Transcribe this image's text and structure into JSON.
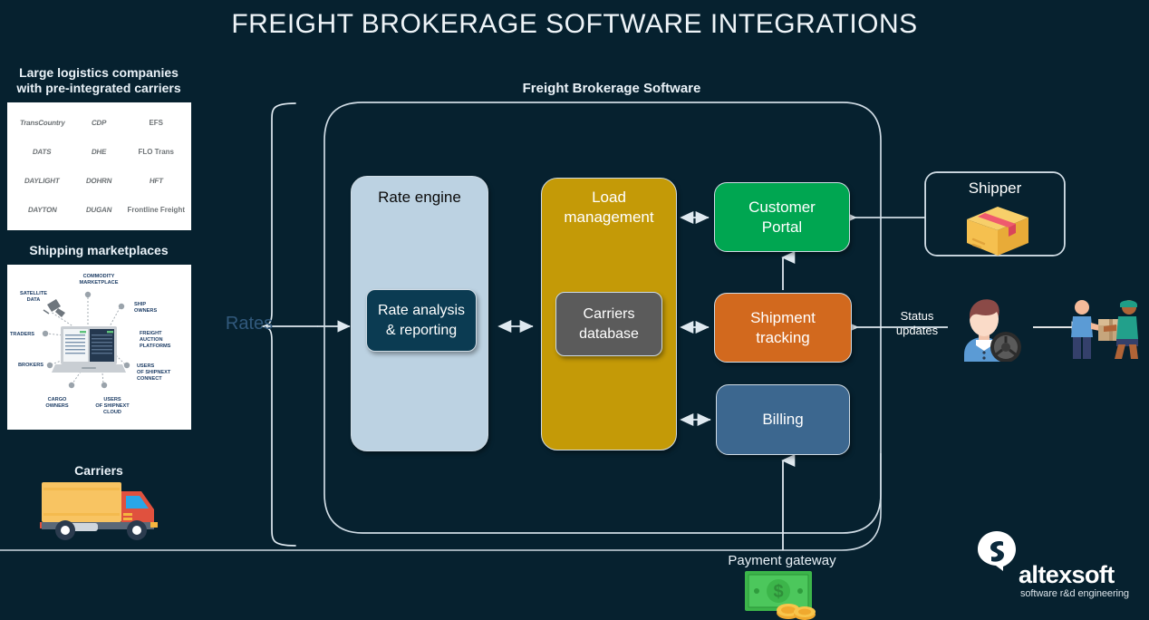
{
  "page": {
    "title": "FREIGHT BROKERAGE SOFTWARE INTEGRATIONS",
    "background_color": "#06212f"
  },
  "left_panel": {
    "logistics_label_line1": "Large logistics companies",
    "logistics_label_line2": "with pre-integrated carriers",
    "marketplaces_label": "Shipping marketplaces",
    "carriers_label": "Carriers",
    "carrier_logos": [
      "TransCountry",
      "CDP",
      "EFS",
      "DATS",
      "DHE",
      "FLO Trans",
      "DAYLIGHT",
      "DOHRN",
      "HFT",
      "DAYTON",
      "DUGAN",
      "Frontline Freight"
    ],
    "marketplace_diagram": {
      "center": "laptop",
      "nodes": [
        "COMMODITY MARKETPLACE",
        "SATELLITE DATA",
        "SHIP OWNERS",
        "FREIGHT AUCTION PLATFORMS",
        "TRADERS",
        "USERS OF SHIPNEXT CONNECT",
        "BROKERS",
        "CARGO OWNERS",
        "USERS OF SHIPNEXT CLOUD"
      ]
    }
  },
  "connector": {
    "rates_label": "Rates"
  },
  "container": {
    "label": "Freight Brokerage Software"
  },
  "nodes": {
    "rate_engine": {
      "label": "Rate engine",
      "color": "#bcd2e2"
    },
    "rate_analysis": {
      "label": "Rate analysis\n& reporting",
      "line1": "Rate analysis",
      "line2": "& reporting",
      "color": "#0b3b52"
    },
    "load_management": {
      "label": "Load\nmanagement",
      "line1": "Load",
      "line2": "management",
      "color": "#c49a07"
    },
    "carriers_database": {
      "line1": "Carriers",
      "line2": "database",
      "color": "#5b5b5b"
    },
    "customer_portal": {
      "line1": "Customer",
      "line2": "Portal",
      "color": "#00a651"
    },
    "shipment_tracking": {
      "line1": "Shipment",
      "line2": "tracking",
      "color": "#d2691e"
    },
    "billing": {
      "label": "Billing",
      "color": "#3c678f"
    },
    "shipper": {
      "label": "Shipper"
    }
  },
  "labels": {
    "status_updates_line1": "Status",
    "status_updates_line2": "updates",
    "payment_gateway": "Payment gateway"
  },
  "brand": {
    "name": "altexsoft",
    "tagline": "software r&d engineering"
  },
  "icons": {
    "package": "package-box-icon",
    "driver": "driver-with-steering-wheel-icon",
    "delivery": "delivery-handoff-icon",
    "money": "money-cash-icon",
    "truck": "delivery-truck-icon",
    "brand_mark": "altexsoft-logo-icon"
  }
}
